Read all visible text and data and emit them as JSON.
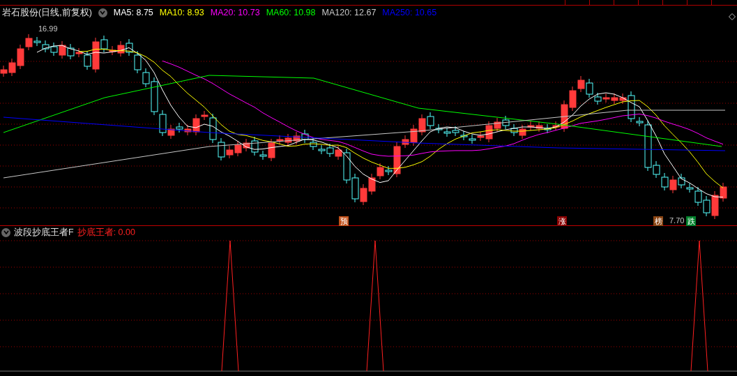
{
  "stock": {
    "title": "岩石股份(日线,前复权)",
    "ma": [
      {
        "label": "MA5: 8.75",
        "color": "#ffffff"
      },
      {
        "label": "MA10: 8.93",
        "color": "#ffff00"
      },
      {
        "label": "MA20: 10.73",
        "color": "#ff00ff"
      },
      {
        "label": "MA60: 10.98",
        "color": "#00ff00"
      },
      {
        "label": "MA120: 12.67",
        "color": "#c8c8c8"
      },
      {
        "label": "MA250: 10.65",
        "color": "#0000ff"
      }
    ]
  },
  "price_labels": [
    {
      "kind": "high",
      "text": "16.99"
    },
    {
      "kind": "low",
      "text": "7.70"
    }
  ],
  "markers": [
    {
      "text": "预",
      "color": "#c0501a"
    },
    {
      "text": "涨",
      "color": "#8b0000"
    },
    {
      "text": "榜",
      "color": "#8b4513"
    },
    {
      "text": "跌",
      "color": "#00802a"
    }
  ],
  "indicator": {
    "name": "波段抄底王者F",
    "value": "抄底王者: 0.00"
  }
}
